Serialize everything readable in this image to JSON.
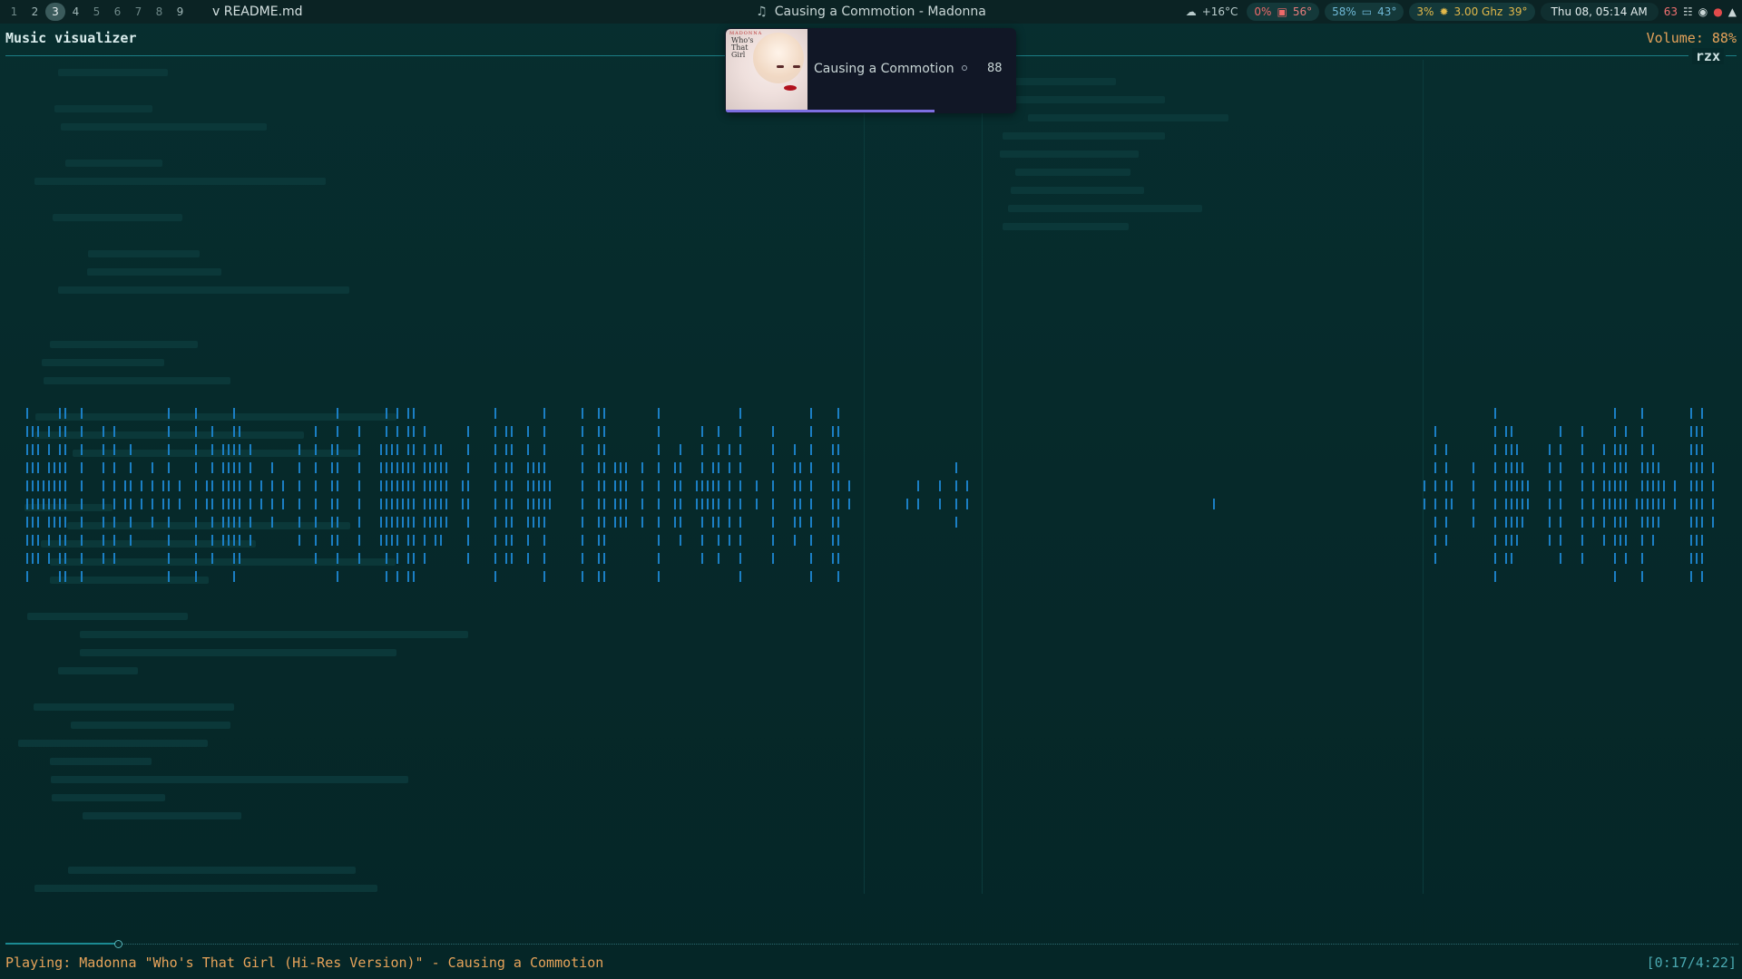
{
  "topbar": {
    "workspaces": [
      {
        "label": "1",
        "active": false,
        "filled": false
      },
      {
        "label": "2",
        "active": false,
        "filled": true
      },
      {
        "label": "3",
        "active": true,
        "filled": true
      },
      {
        "label": "4",
        "active": false,
        "filled": true
      },
      {
        "label": "5",
        "active": false,
        "filled": false
      },
      {
        "label": "6",
        "active": false,
        "filled": false
      },
      {
        "label": "7",
        "active": false,
        "filled": false
      },
      {
        "label": "8",
        "active": false,
        "filled": false
      },
      {
        "label": "9",
        "active": false,
        "filled": true
      }
    ],
    "window_title": "v README.md",
    "now_playing": "Causing a Commotion - Madonna",
    "weather": "+16°C",
    "cpu_usage": "0%",
    "cpu_temp": "56°",
    "mem_usage": "58%",
    "disk_temp": "43°",
    "gpu_usage": "3%",
    "cpu_freq": "3.00 Ghz",
    "gpu_temp": "39°",
    "clock": "Thu 08, 05:14 AM",
    "notif_count": "63"
  },
  "visualizer": {
    "title": "Music visualizer",
    "volume": "Volume: 88%",
    "frame_label": "rzx",
    "bar_color": "#1b7fc4"
  },
  "notification": {
    "title": "Causing a Commotion",
    "value": "88",
    "progress": 0.72,
    "cover_text_top": "MADONNA",
    "cover_text_album": "Who's That Girl"
  },
  "player": {
    "status_label": "Playing:",
    "status_text": "Madonna \"Who's That Girl (Hi-Res Version)\" - Causing a Commotion",
    "time": "[0:17/4:22]",
    "progress": 0.065
  }
}
